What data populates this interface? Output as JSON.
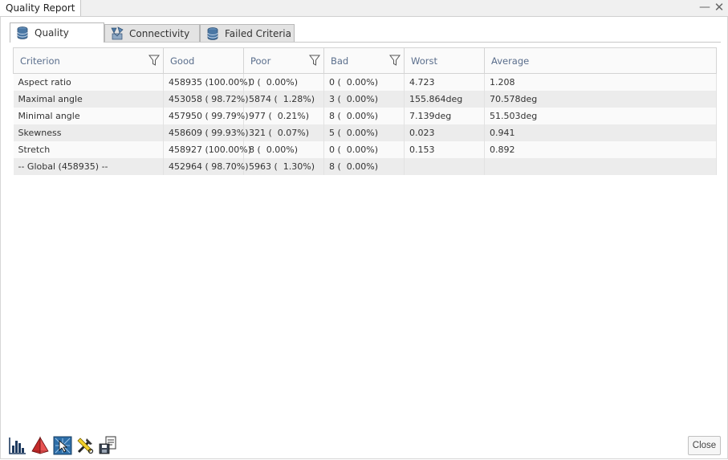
{
  "window": {
    "title": "Quality Report",
    "minimize_glyph": "—",
    "close_glyph": "✕"
  },
  "tabs": [
    {
      "label": "Quality",
      "icon": "database-icon",
      "active": true
    },
    {
      "label": "Connectivity",
      "icon": "connectivity-icon",
      "active": false
    },
    {
      "label": "Failed Criteria",
      "icon": "database-icon",
      "active": false
    }
  ],
  "table": {
    "columns": [
      "Criterion",
      "Good",
      "Poor",
      "Bad",
      "Worst",
      "Average"
    ],
    "rows": [
      {
        "criterion": "Aspect ratio",
        "good": "458935 (100.00%)",
        "poor": "0 (  0.00%)",
        "bad": "0 (  0.00%)",
        "worst": "4.723",
        "average": "1.208"
      },
      {
        "criterion": "Maximal angle",
        "good": "453058 ( 98.72%)",
        "poor": "5874 (  1.28%)",
        "bad": "3 (  0.00%)",
        "worst": "155.864deg",
        "average": "70.578deg"
      },
      {
        "criterion": "Minimal angle",
        "good": "457950 ( 99.79%)",
        "poor": "977 (  0.21%)",
        "bad": "8 (  0.00%)",
        "worst": "7.139deg",
        "average": "51.503deg"
      },
      {
        "criterion": "Skewness",
        "good": "458609 ( 99.93%)",
        "poor": "321 (  0.07%)",
        "bad": "5 (  0.00%)",
        "worst": "0.023",
        "average": "0.941"
      },
      {
        "criterion": "Stretch",
        "good": "458927 (100.00%)",
        "poor": "8 (  0.00%)",
        "bad": "0 (  0.00%)",
        "worst": "0.153",
        "average": "0.892"
      },
      {
        "criterion": "-- Global (458935) --",
        "good": "452964 ( 98.70%)",
        "poor": "5963 (  1.30%)",
        "bad": "8 (  0.00%)",
        "worst": "",
        "average": ""
      }
    ]
  },
  "toolbar": {
    "icons": [
      "histogram-icon",
      "mesh-element-icon",
      "select-elements-icon",
      "repair-tools-icon",
      "export-report-icon"
    ]
  },
  "footer": {
    "close_label": "Close"
  },
  "colors": {
    "header_text": "#5a6e8c",
    "row_odd": "#fafafa",
    "row_even": "#ececec",
    "tab_inactive": "#e3e3e3"
  }
}
